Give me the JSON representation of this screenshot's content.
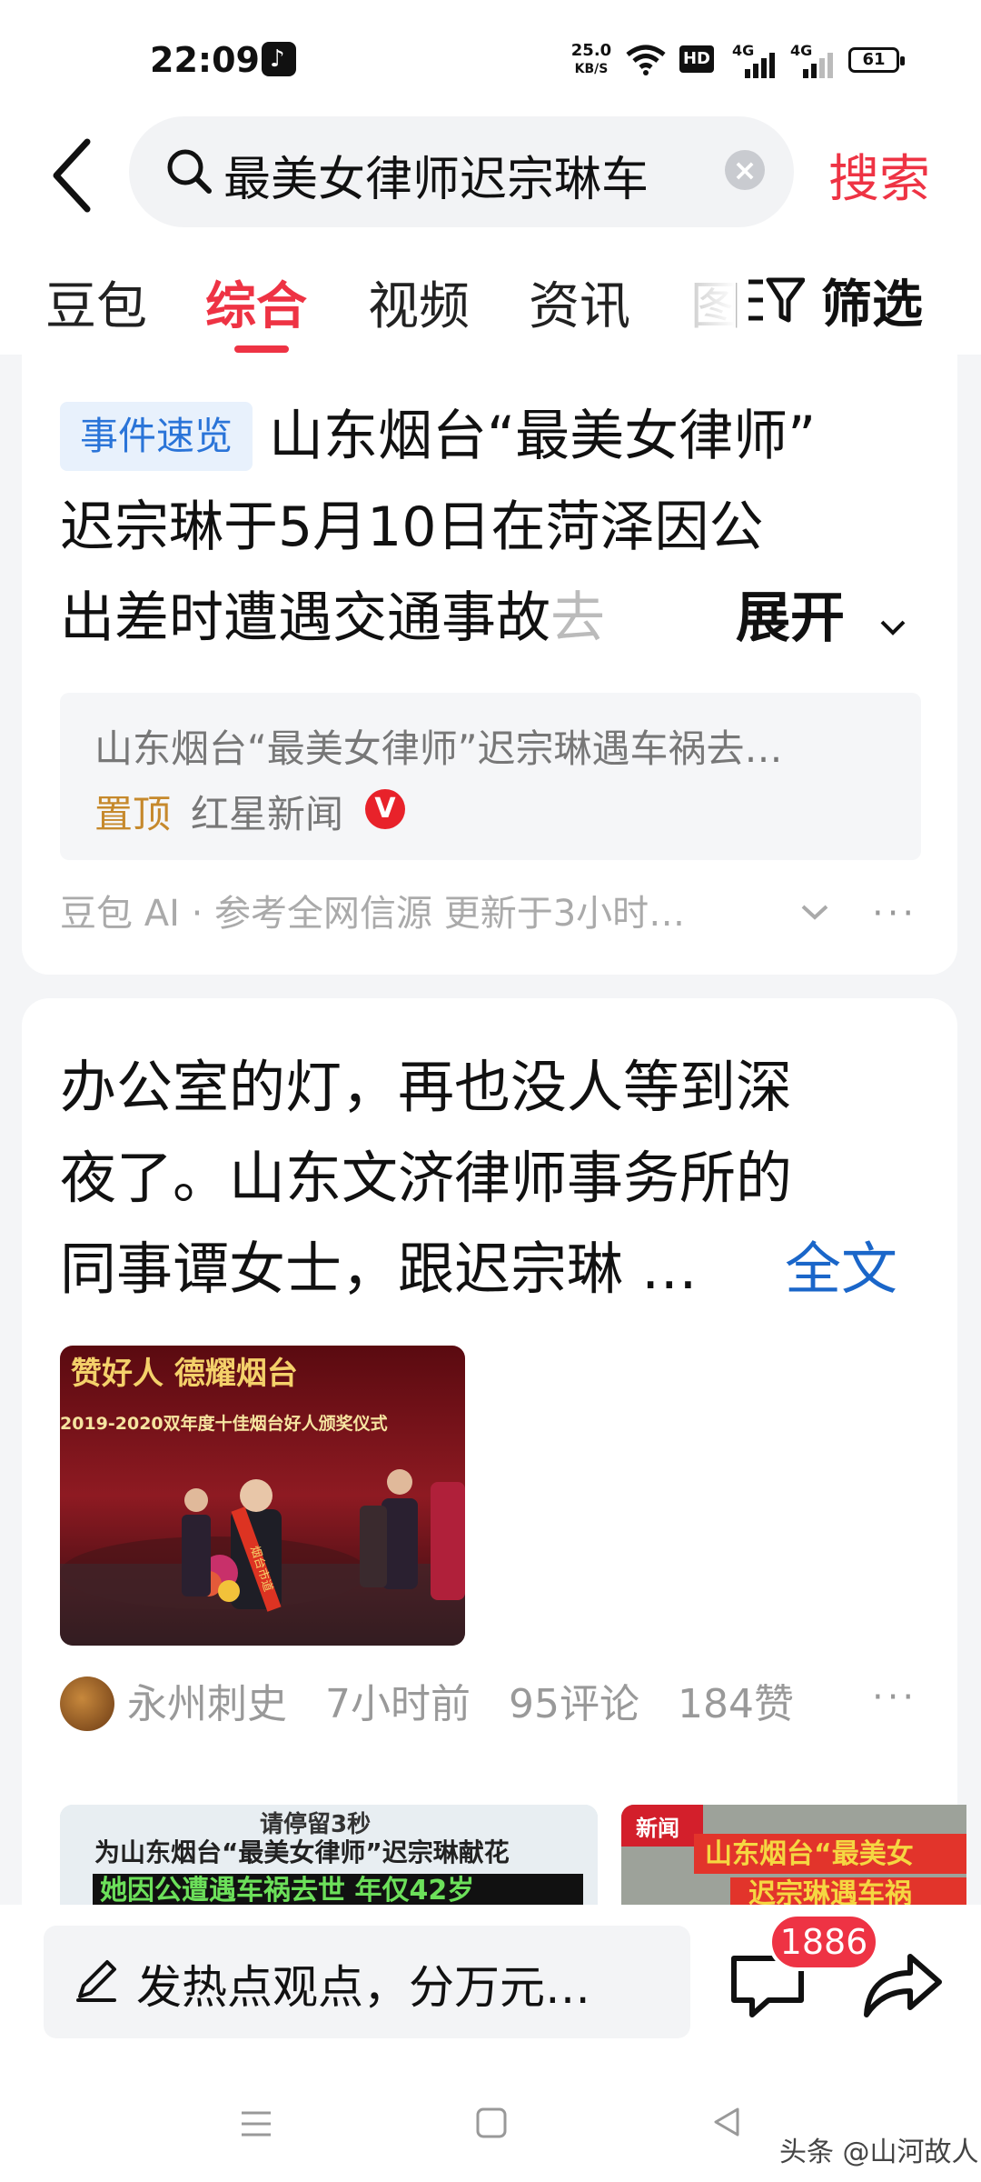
{
  "status_bar": {
    "time": "22:09",
    "network_speed": "25.0",
    "network_speed_unit": "KB/S",
    "hd_label": "HD",
    "signal_1_label": "4G",
    "signal_2_label": "4G",
    "battery": "61",
    "app_icon": "tiktok-icon"
  },
  "search": {
    "query": "最美女律师迟宗琳车",
    "search_button": "搜索"
  },
  "tabs": [
    {
      "label": "豆包"
    },
    {
      "label": "综合",
      "active": true
    },
    {
      "label": "视频"
    },
    {
      "label": "资讯"
    },
    {
      "label": "图"
    }
  ],
  "filter_label": "筛选",
  "card1": {
    "tag": "事件速览",
    "line1": "山东烟台“最美女律师”",
    "line2": "迟宗琳于5月10日在菏泽因公",
    "line3_main": "出差时遭遇交通事故",
    "line3_fade": "去",
    "expand": "展开",
    "quote_title": "山东烟台“最美女律师”迟宗琳遇车祸去…",
    "pinned": "置顶",
    "source": "红星新闻",
    "verified": "V",
    "footer": "豆包 AI · 参考全网信源 更新于3小时…"
  },
  "card2": {
    "line1": "办公室的灯，再也没人等到深",
    "line2": "夜了。山东文济律师事务所的",
    "line3": "同事谭女士，跟迟宗琳 …",
    "full_text": "全文",
    "photo_banner_1": "赞好人  德耀烟台",
    "photo_banner_2": "2019-2020双年度十佳烟台好人颁奖仪式",
    "photo_sash": "烟台市道",
    "author": "永州刺史",
    "time_ago": "7小时前",
    "comments": "95评论",
    "likes": "184赞"
  },
  "thumbnails": [
    {
      "line0": "请停留3秒",
      "line1": "为山东烟台“最美女律师”迟宗琳献花",
      "line2": "她因公遭遇车祸去世 年仅42岁"
    },
    {
      "badge": "新闻",
      "line1": "山东烟台“最美女",
      "line2": "迟宗琳遇车祸"
    }
  ],
  "bottom": {
    "comment_placeholder": "发热点观点，分万元…",
    "comment_count": "1886"
  },
  "watermark": "头条 @山河故人",
  "colors": {
    "accent": "#ee3344",
    "link": "#1a66c9",
    "tag_bg": "#e8f1fc",
    "tag_text": "#2a74d8",
    "pinned": "#c6892c"
  }
}
